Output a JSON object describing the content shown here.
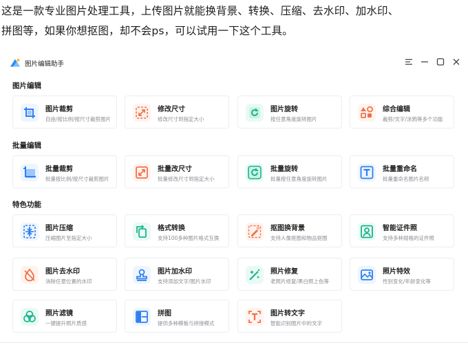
{
  "intro": {
    "line1": "这是一款专业图片处理工具，上传图片就能换背景、转换、压缩、去水印、加水印、",
    "line2": "拼图等，如果你想抠图，却不会ps，可以试用一下这个工具。"
  },
  "app": {
    "title": "图片编辑助手",
    "window_controls": [
      "menu-icon",
      "minimize-icon",
      "maximize-icon",
      "close-icon"
    ]
  },
  "sections": [
    {
      "title": "图片编辑",
      "cards": [
        {
          "name": "图片裁剪",
          "desc": "自由/按比例/按尺寸裁剪图片",
          "icon": "crop-icon"
        },
        {
          "name": "修改尺寸",
          "desc": "修改尺寸到指定大小",
          "icon": "resize-icon"
        },
        {
          "name": "图片旋转",
          "desc": "按任意角度旋转图片",
          "icon": "rotate-icon"
        },
        {
          "name": "综合编辑",
          "desc": "裁剪/文字/涂鸦等多个功能",
          "icon": "shapes-icon"
        }
      ]
    },
    {
      "title": "批量编辑",
      "cards": [
        {
          "name": "批量裁剪",
          "desc": "批量按比例/按尺寸裁剪图片",
          "icon": "batch-crop-icon"
        },
        {
          "name": "批量改尺寸",
          "desc": "批量修改尺寸到指定大小",
          "icon": "batch-resize-icon"
        },
        {
          "name": "批量旋转",
          "desc": "批量按任意角度旋转图片",
          "icon": "batch-rotate-icon"
        },
        {
          "name": "批量重命名",
          "desc": "批量重命名图片名称",
          "icon": "rename-icon"
        }
      ]
    },
    {
      "title": "特色功能",
      "cards": [
        {
          "name": "图片压缩",
          "desc": "压缩图片至指定大小",
          "icon": "compress-icon"
        },
        {
          "name": "格式转换",
          "desc": "支持100多种图片格式互换",
          "icon": "convert-icon"
        },
        {
          "name": "抠图换背景",
          "desc": "支持人像抠图和物品抠图",
          "icon": "cutout-icon"
        },
        {
          "name": "智能证件照",
          "desc": "支持多种规格的证件照",
          "icon": "id-photo-icon"
        },
        {
          "name": "图片去水印",
          "desc": "消除任意位置的水印",
          "icon": "remove-watermark-icon"
        },
        {
          "name": "图片加水印",
          "desc": "支持添加文字/图片水印",
          "icon": "add-watermark-icon"
        },
        {
          "name": "照片修复",
          "desc": "老照片修复/黑白照上色等",
          "icon": "photo-repair-icon"
        },
        {
          "name": "照片特效",
          "desc": "性别变化/年龄变化等",
          "icon": "photo-effect-icon"
        },
        {
          "name": "照片滤镜",
          "desc": "一键提升照片质感",
          "icon": "filter-icon"
        },
        {
          "name": "拼图",
          "desc": "提供多种模板与拼接模式",
          "icon": "collage-icon"
        },
        {
          "name": "图片转文字",
          "desc": "智能识别图片中的文字",
          "icon": "ocr-icon"
        }
      ]
    }
  ]
}
